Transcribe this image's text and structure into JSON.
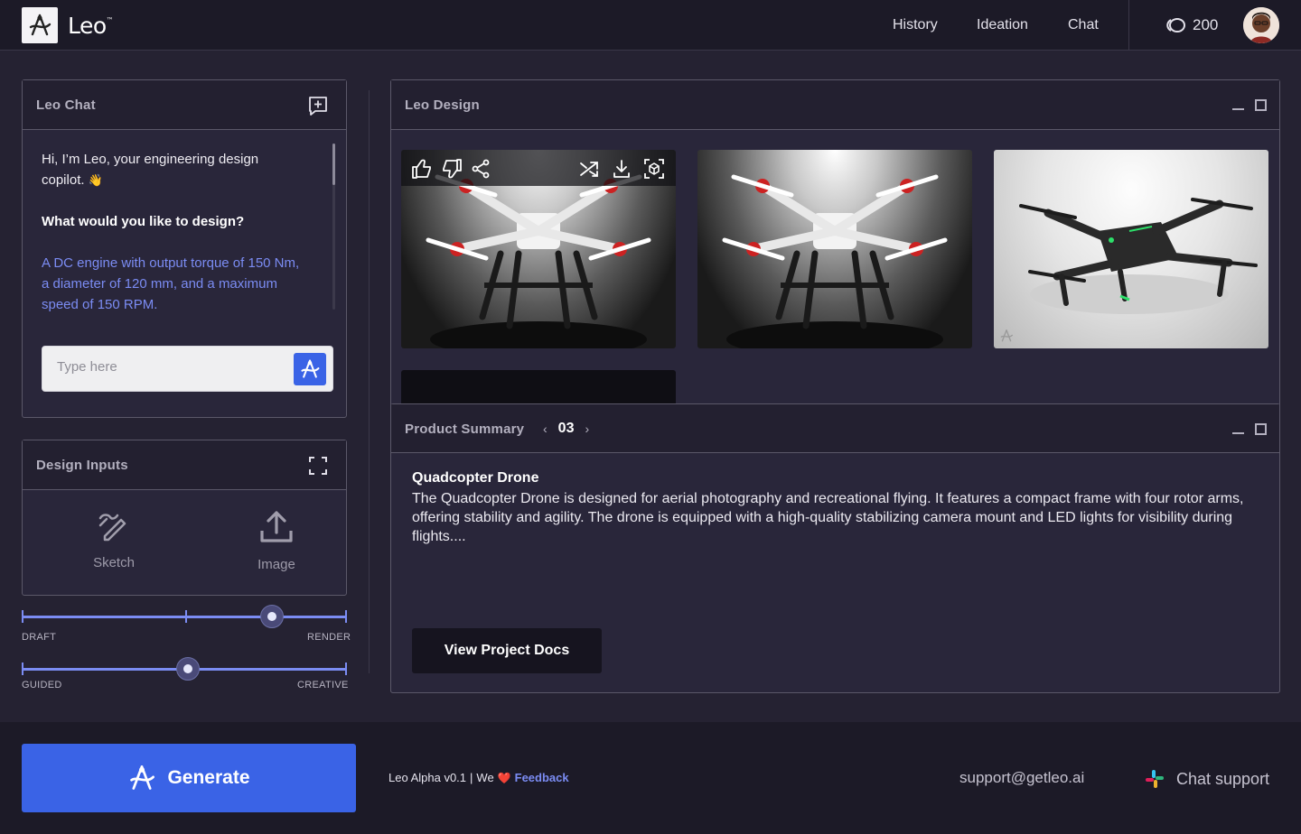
{
  "app": {
    "name": "Leo",
    "trademark": "™"
  },
  "nav": {
    "items": [
      "History",
      "Ideation",
      "Chat"
    ],
    "credits": "200"
  },
  "chat": {
    "title": "Leo Chat",
    "greeting": "Hi, I’m Leo, your engineering design copilot.",
    "greeting_emoji": "👋",
    "question": "What would you like to design?",
    "user_message": "A DC engine with output torque of 150 Nm, a diameter of 120 mm, and a maximum speed of 150 RPM.",
    "input_placeholder": "Type here"
  },
  "design_inputs": {
    "title": "Design Inputs",
    "options": [
      {
        "label": "Sketch",
        "icon": "sketch-icon"
      },
      {
        "label": "Image",
        "icon": "upload-icon"
      }
    ]
  },
  "sliders": [
    {
      "left_label": "DRAFT",
      "right_label": "RENDER",
      "value": 0.77
    },
    {
      "left_label": "GUIDED",
      "right_label": "CREATIVE",
      "value": 0.51
    }
  ],
  "design": {
    "title": "Leo Design",
    "images": [
      {
        "alt": "quadcopter-render-1",
        "style": "dark"
      },
      {
        "alt": "quadcopter-render-2",
        "style": "dark"
      },
      {
        "alt": "quadcopter-render-3",
        "style": "light"
      }
    ]
  },
  "summary": {
    "title": "Product Summary",
    "page": "03",
    "product_name": "Quadcopter Drone",
    "description": "The Quadcopter Drone is designed for aerial photography and recreational  flying. It features a compact frame with four rotor arms, offering  stability and agility. The drone is equipped with a high-quality  stabilizing camera mount and LED lights for visibility during flights....",
    "docs_button": "View Project Docs"
  },
  "footer": {
    "generate_label": "Generate",
    "version": "Leo Alpha v0.1",
    "separator": "|",
    "we": "We",
    "heart": "❤️",
    "feedback": "Feedback",
    "email": "support@getleo.ai",
    "chat_support": "Chat support"
  },
  "colors": {
    "accent": "#3a63e6",
    "link": "#7b8cf3",
    "bg": "#252232",
    "bar": "#1c1a27"
  }
}
